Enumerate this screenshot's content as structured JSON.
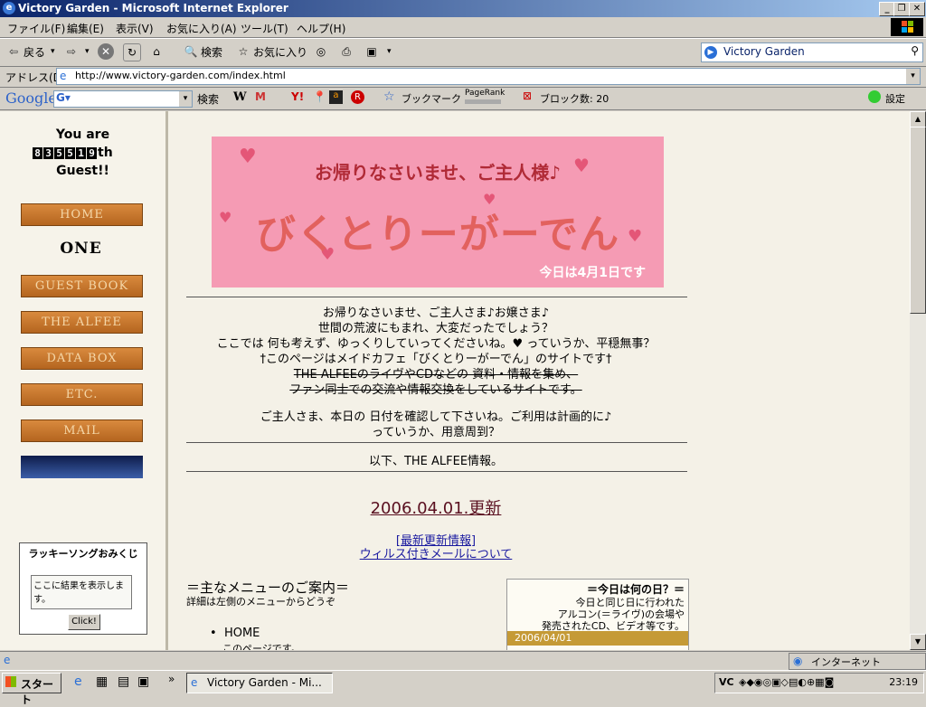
{
  "window": {
    "title": "Victory Garden - Microsoft Internet Explorer"
  },
  "menu": [
    "ファイル(F)",
    "編集(E)",
    "表示(V)",
    "お気に入り(A)",
    "ツール(T)",
    "ヘルプ(H)"
  ],
  "toolbar": {
    "back": "戻る",
    "search": "検索",
    "favorites": "お気に入り",
    "search_box": "Victory Garden"
  },
  "address": {
    "label": "アドレス(D)",
    "url": "http://www.victory-garden.com/index.html"
  },
  "google": {
    "logo": "Google",
    "search_btn": "検索",
    "bookmark": "ブックマーク",
    "pagerank": "PageRank",
    "blocked": "ブロック数: 20",
    "settings": "設定"
  },
  "sidebar": {
    "you_are": "You are",
    "counter": [
      "8",
      "3",
      "5",
      "5",
      "1",
      "9"
    ],
    "th": "th",
    "guest": "Guest!!",
    "nav": [
      "HOME",
      "ONE",
      "GUEST BOOK",
      "THE ALFEE",
      "DATA BOX",
      "ETC.",
      "MAIL"
    ],
    "lucky_title": "ラッキーソングおみくじ",
    "lucky_text": "ここに結果を表示します。",
    "lucky_button": "Click!"
  },
  "banner": {
    "line1": "お帰りなさいませ、ご主人様♪",
    "line2": "びくとりーがーでん",
    "line3": "今日は4月1日です"
  },
  "intro": [
    "お帰りなさいませ、ご主人さま♪お嬢さま♪",
    "世間の荒波にもまれ、大変だったでしょう？",
    "ここでは 何も考えず、ゆっくりしていってくださいね。♥ っていうか、平穏無事？",
    "†このページはメイドカフェ「びくとりーがーでん」のサイトです†",
    "THE ALFEEのライヴやCDなどの 資料・情報を集め、",
    "ファン同士での交流や情報交換をしているサイトです。",
    "ご主人さま、本日の 日付を確認して下さいね。ご利用は計画的に♪",
    "っていうか、用意周到？"
  ],
  "alfee_info": "以下、THE ALFEE情報。",
  "update": {
    "title": "2006.04.01.更新",
    "link1": "[最新更新情報]",
    "link2": "ウィルス付きメールについて"
  },
  "menu_guide": {
    "title": "＝主なメニューのご案内＝",
    "subtitle": "詳細は左側のメニューからどうぞ",
    "item": "HOME",
    "item_desc": "このページです。"
  },
  "today": {
    "title": "＝今日は何の日？＝",
    "l1": "今日と同じ日に行われた",
    "l2": "アルコン(＝ライヴ)の会場や",
    "l3": "発売されたCD、ビデオ等です。",
    "date": "2006/04/01"
  },
  "status": {
    "zone": "インターネット"
  },
  "taskbar": {
    "start": "スタート",
    "task": "Victory Garden - Mi...",
    "clock": "23:19"
  },
  "colors": {
    "title_blue": "#0a246a",
    "banner_pink": "#f59bb4",
    "nav_brown": "#c77a33"
  }
}
